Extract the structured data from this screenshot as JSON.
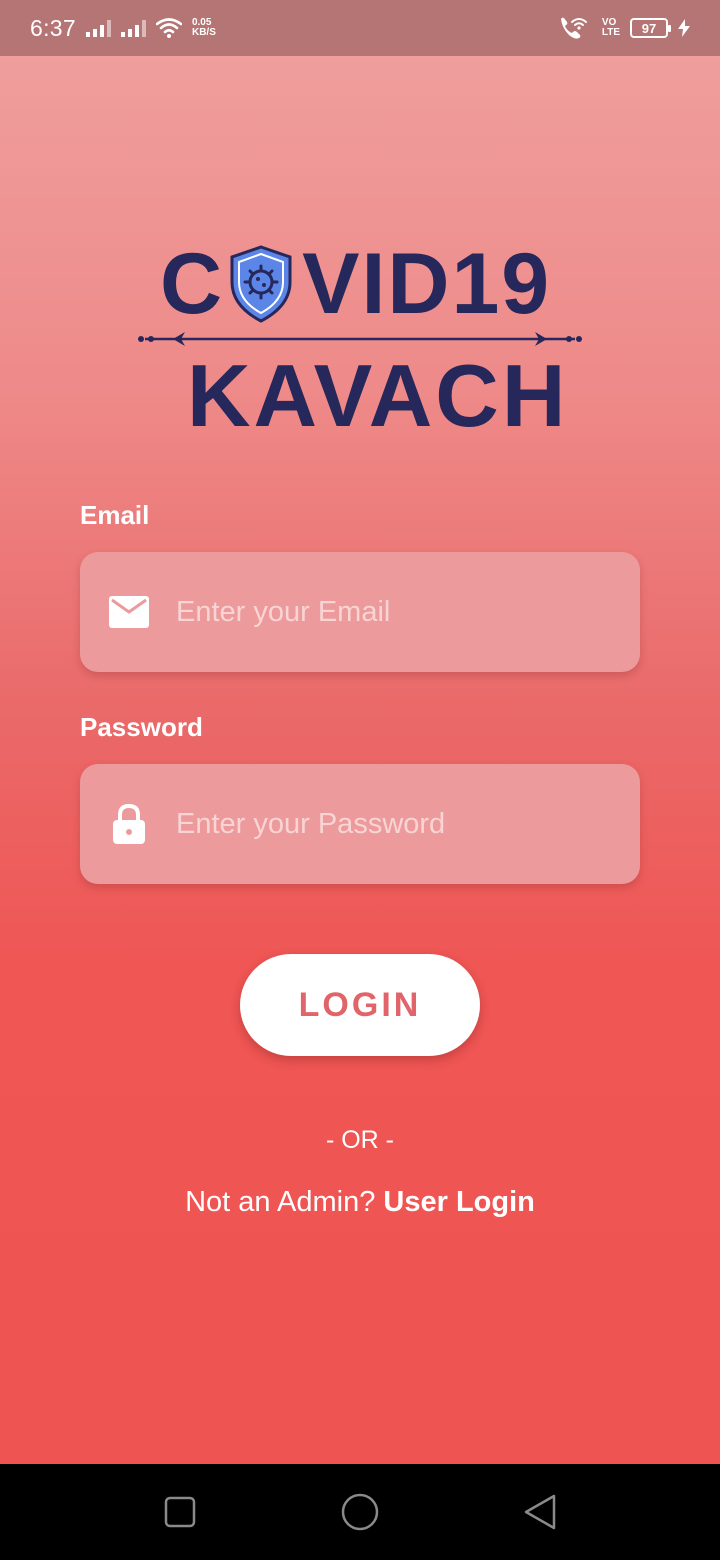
{
  "status_bar": {
    "time": "6:37",
    "speed_value": "0.05",
    "speed_unit": "KB/S",
    "volte_top": "VO",
    "volte_bottom": "LTE",
    "battery": "97"
  },
  "logo": {
    "line1_prefix": "C",
    "line1_suffix": "VID19",
    "line2": "KAVACH",
    "primary_color": "#26275a",
    "shield_color": "#5b86e8"
  },
  "form": {
    "email_label": "Email",
    "email_placeholder": "Enter your Email",
    "password_label": "Password",
    "password_placeholder": "Enter your Password",
    "login_button": "LOGIN"
  },
  "footer": {
    "or_text": "- OR -",
    "alt_prompt": "Not an Admin? ",
    "alt_link": "User Login"
  },
  "colors": {
    "accent": "#e06469",
    "input_bg": "#ec9a9b"
  }
}
